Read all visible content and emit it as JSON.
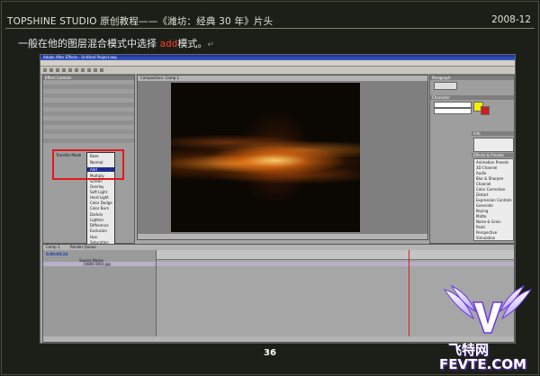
{
  "header": {
    "title": "TOPSHINE STUDIO 原创教程——《潍坊：经典 30 年》片头",
    "date": "2008-12"
  },
  "instruction": {
    "before": "一般在他的图层混合模式中选择 ",
    "highlight": "add",
    "after": "模式。"
  },
  "page_number": "36",
  "screenshot": {
    "app_title": "Adobe After Effects - Untitled Project.aep",
    "workspace": "Workspace: Effects",
    "panels": {
      "effect_controls": "Effect Controls",
      "composition": "Composition: Comp 1",
      "paragraph": "Paragraph",
      "character": "Character",
      "info": "Info",
      "audio": "Audio",
      "effects_presets": "Effects & Presets",
      "timeline_tab": "Comp 1",
      "render_queue": "Render Queue"
    },
    "transfer_mode_label": "Transfer Mode",
    "blend_modes": [
      "Base",
      "Normal",
      "Add",
      "Multiply",
      "Screen",
      "Overlay",
      "Soft Light",
      "Hard Light",
      "Color Dodge",
      "Color Burn",
      "Darken",
      "Lighten",
      "Difference",
      "Exclusion",
      "Hue",
      "Saturation",
      "Color",
      "Luminosity"
    ],
    "selected_blend_mode": "Add",
    "timecode": "0:00:00:24",
    "layer_name": "[0806 000].jpg",
    "source_name_col": "Source Name",
    "effects_categories": [
      "Animation Presets",
      "3D Channel",
      "Audio",
      "Blur & Sharpen",
      "Channel",
      "Color Correction",
      "Distort",
      "Expression Controls",
      "Generate",
      "Keying",
      "Matte",
      "Noise & Grain",
      "Paint",
      "Perspective",
      "Simulation"
    ]
  },
  "watermark": {
    "brand": "飞特网",
    "domain": "FEVTE.COM"
  }
}
